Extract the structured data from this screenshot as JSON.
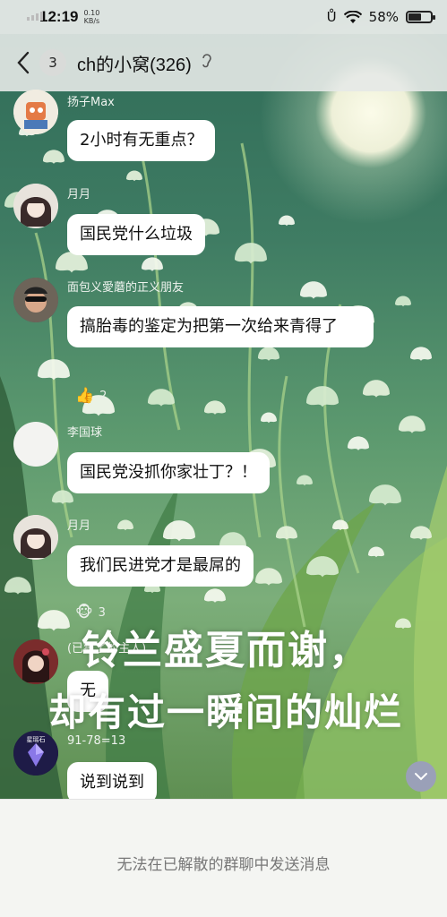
{
  "status": {
    "time": "12:19",
    "speed_value": "0.10",
    "speed_unit": "KB/s",
    "battery": "58%"
  },
  "header": {
    "back_count": "3",
    "title": "ch的小窝(326)"
  },
  "messages": [
    {
      "sender": "扬子Max",
      "text": "2小时有无重点？"
    },
    {
      "sender": "月月",
      "text": "国民党什么垃圾"
    },
    {
      "sender": "面包义愛蘑的正义朋友",
      "text": "搞胎毒的鉴定为把第一次给来青得了",
      "reaction_count": "2"
    },
    {
      "sender": "李国球",
      "text": "国民党没抓你家壮丁？！"
    },
    {
      "sender": "月月",
      "text": "我们民进党才是最屌的",
      "reaction_count": "3"
    },
    {
      "sender": "(已疯了的主人)",
      "text": "无"
    },
    {
      "sender": "91-78=13",
      "text": "说到说到",
      "avatar_text": "星瑶石"
    }
  ],
  "overlay": {
    "line1": "铃兰盛夏而谢，",
    "line2": "却有过一瞬间的灿烂"
  },
  "footer": {
    "note": "无法在已解散的群聊中发送消息"
  }
}
